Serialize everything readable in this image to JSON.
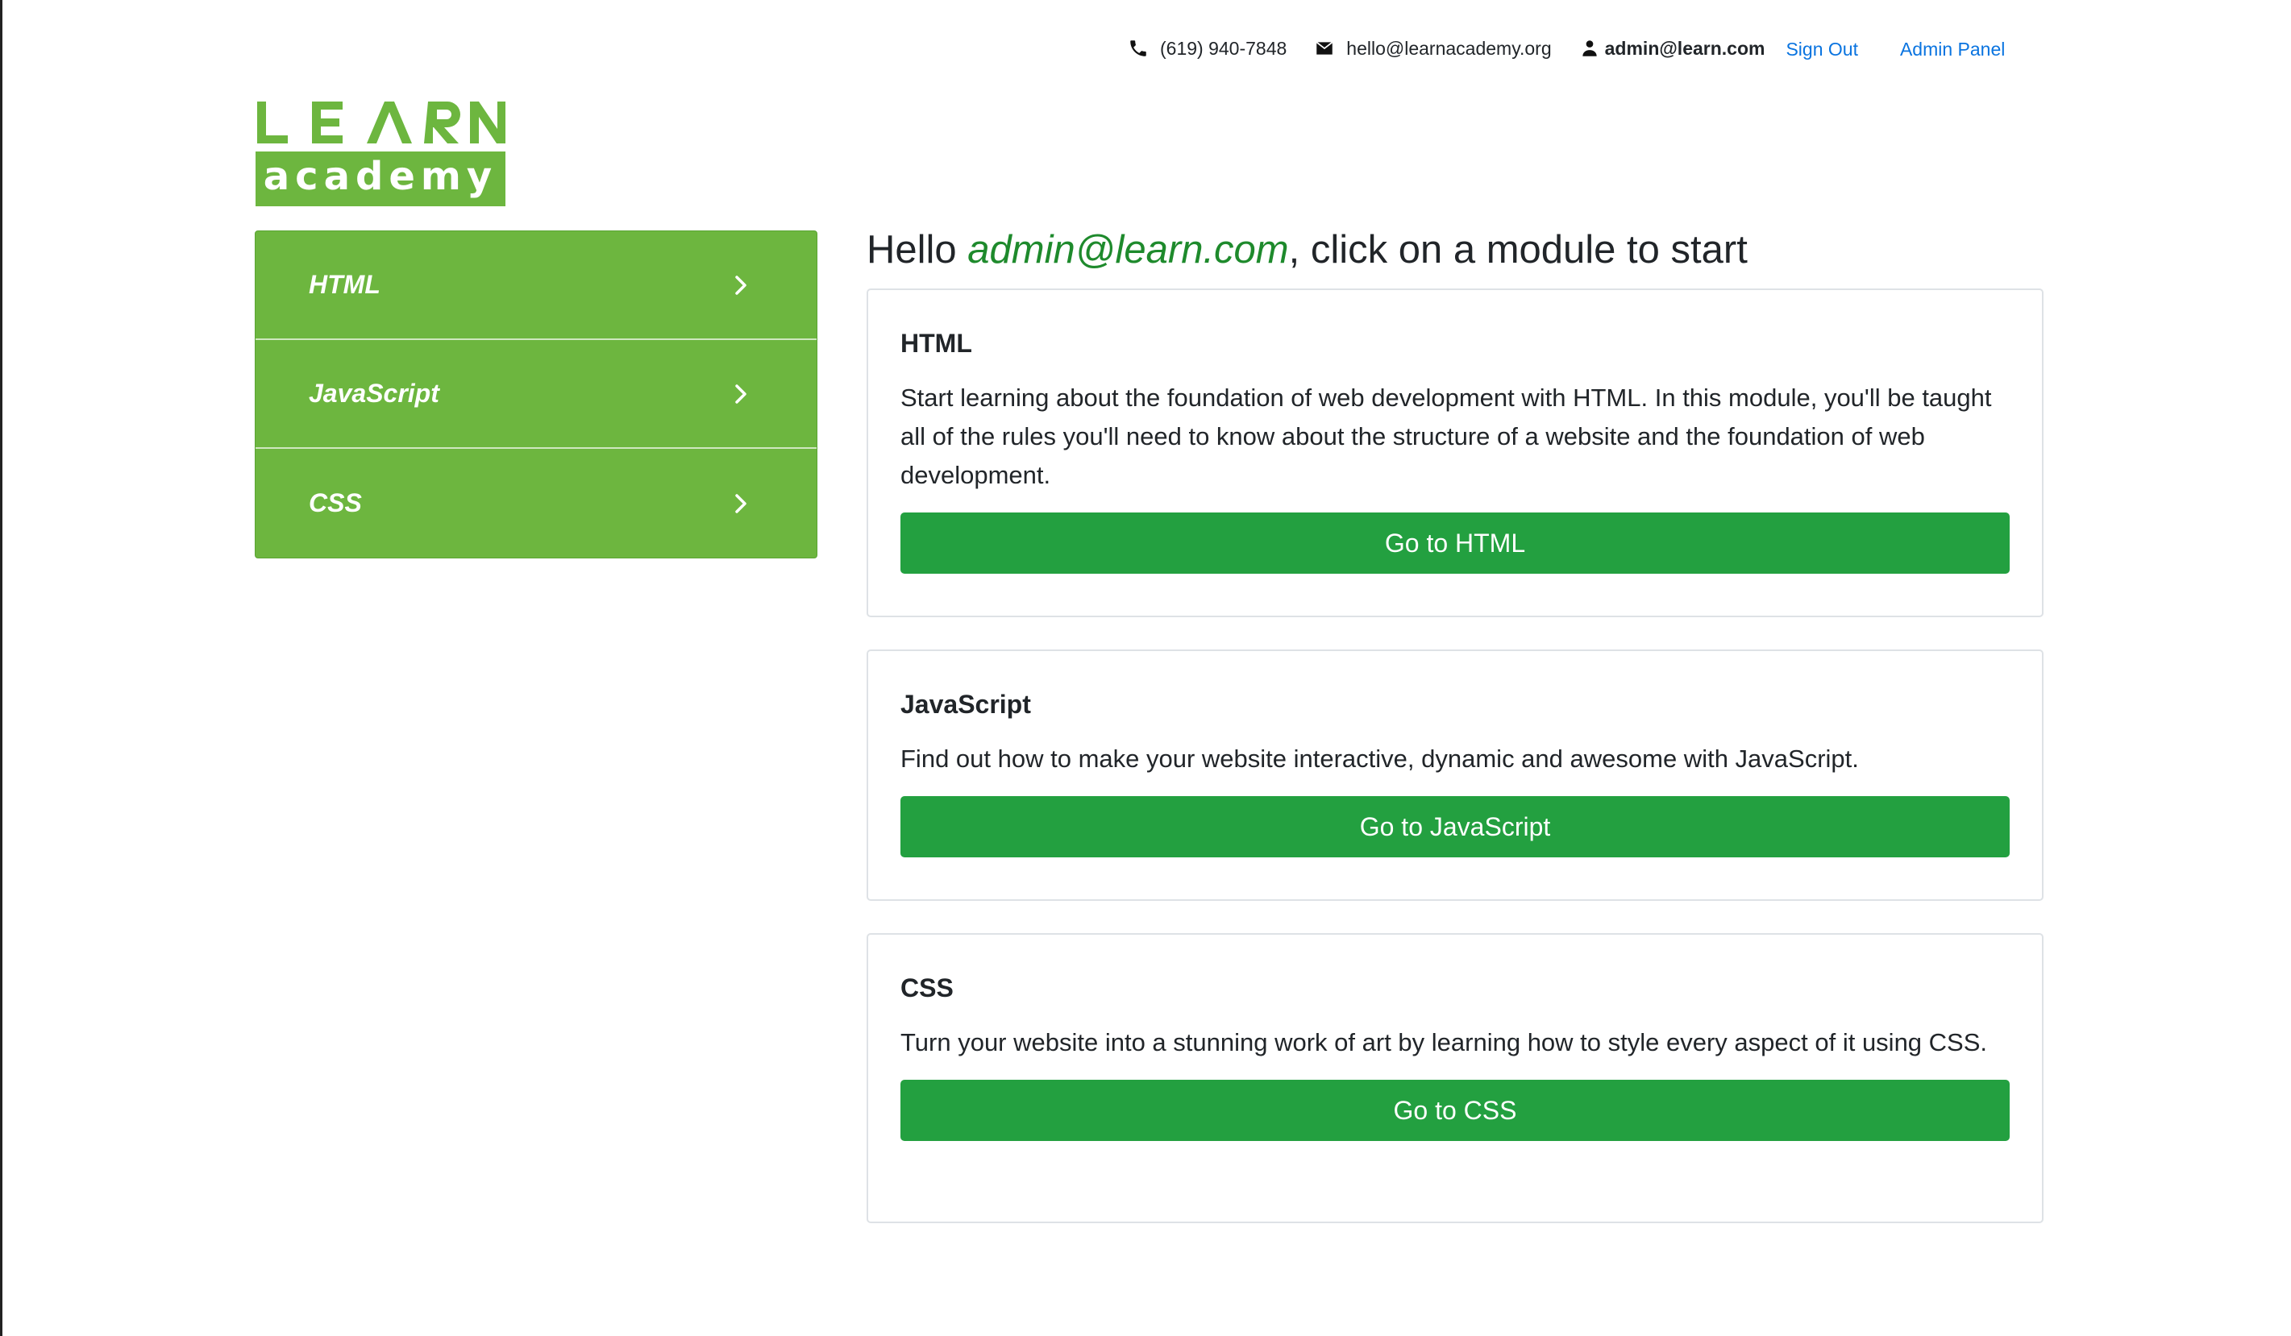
{
  "header": {
    "phone": "(619) 940-7848",
    "email": "hello@learnacademy.org",
    "user": "admin@learn.com",
    "sign_out": "Sign Out",
    "admin_panel": "Admin Panel",
    "icons": {
      "phone": "phone-icon",
      "email": "envelope-icon",
      "user": "user-icon"
    }
  },
  "logo": {
    "top_text": "LEARN",
    "bottom_text": "academy",
    "color": "#6db63f"
  },
  "sidebar": {
    "items": [
      {
        "label": "HTML",
        "icon": "chevron-right-icon"
      },
      {
        "label": "JavaScript",
        "icon": "chevron-right-icon"
      },
      {
        "label": "CSS",
        "icon": "chevron-right-icon"
      }
    ],
    "background": "#6db63f"
  },
  "main": {
    "greeting_prefix": "Hello ",
    "greeting_user": "admin@learn.com",
    "greeting_suffix": ", click on a module to start",
    "modules": [
      {
        "title": "HTML",
        "description": "Start learning about the foundation of web development with HTML. In this module, you'll be taught all of the rules you'll need to know about the structure of a website and the foundation of web development.",
        "button": "Go to HTML"
      },
      {
        "title": "JavaScript",
        "description": "Find out how to make your website interactive, dynamic and awesome with JavaScript.",
        "button": "Go to JavaScript"
      },
      {
        "title": "CSS",
        "description": "Turn your website into a stunning work of art by learning how to style every aspect of it using CSS.",
        "button": "Go to CSS"
      }
    ],
    "button_color": "#23a040",
    "link_color": "#0a74e0",
    "user_color": "#1e8a2c"
  }
}
